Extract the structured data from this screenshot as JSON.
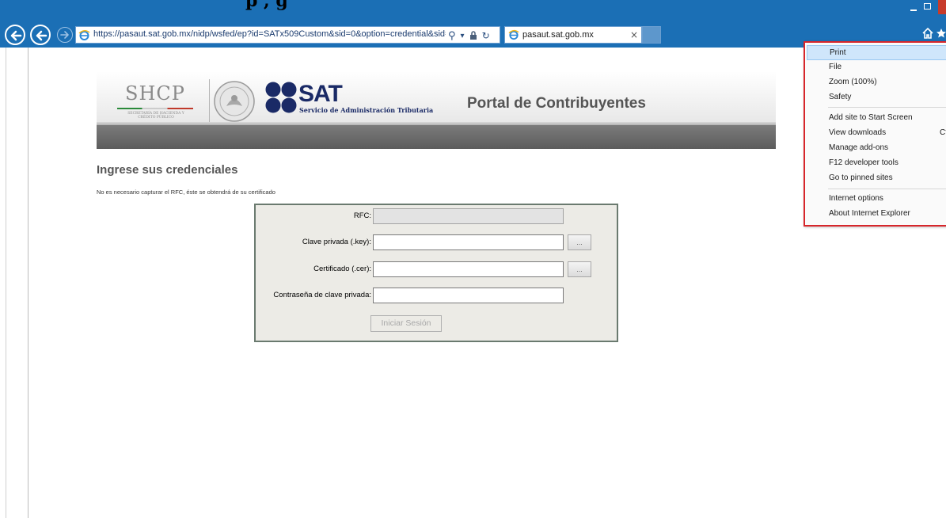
{
  "window": {
    "caption": "p                                             ,                                       g"
  },
  "browser": {
    "url": "https://pasaut.sat.gob.mx/nidp/wsfed/ep?id=SATx509Custom&sid=0&option=credential&sid=0",
    "tab_title": "pasaut.sat.gob.mx",
    "tab_close": "×",
    "search_glyph": "⚲",
    "refresh_glyph": "↻",
    "dropdown_glyph": "▾"
  },
  "header": {
    "shcp": "SHCP",
    "shcp_sub": "SECRETARÍA DE HACIENDA Y CRÉDITO PÚBLICO",
    "sat": "SAT",
    "sat_sub": "Servicio de Administración Tributaria",
    "portal": "Portal de Contribuyentes"
  },
  "page": {
    "heading": "Ingrese sus credenciales",
    "note": "No es necesario capturar el RFC, éste se obtendrá de su certificado"
  },
  "form": {
    "rfc_label": "RFC:",
    "rfc_value": "",
    "key_label": "Clave privada (.key):",
    "key_value": "",
    "cer_label": "Certificado (.cer):",
    "cer_value": "",
    "password_label": "Contraseña de clave privada:",
    "password_value": "",
    "browse_label": "...",
    "submit_label": "Iniciar Sesión"
  },
  "menu": {
    "items": [
      {
        "label": "Print"
      },
      {
        "label": "File"
      },
      {
        "label": "Zoom (100%)"
      },
      {
        "label": "Safety"
      },
      {
        "label": "Add site to Start Screen"
      },
      {
        "label": "View downloads",
        "shortcut": "Ct"
      },
      {
        "label": "Manage add-ons"
      },
      {
        "label": "F12 developer tools"
      },
      {
        "label": "Go to pinned sites"
      },
      {
        "label": "Internet options"
      },
      {
        "label": "About Internet Explorer"
      }
    ]
  },
  "colors": {
    "chrome_blue": "#1b6fb5",
    "menu_highlight": "#cfe6fb",
    "menu_outline": "#d7262b",
    "sat_navy": "#1a2a66"
  }
}
